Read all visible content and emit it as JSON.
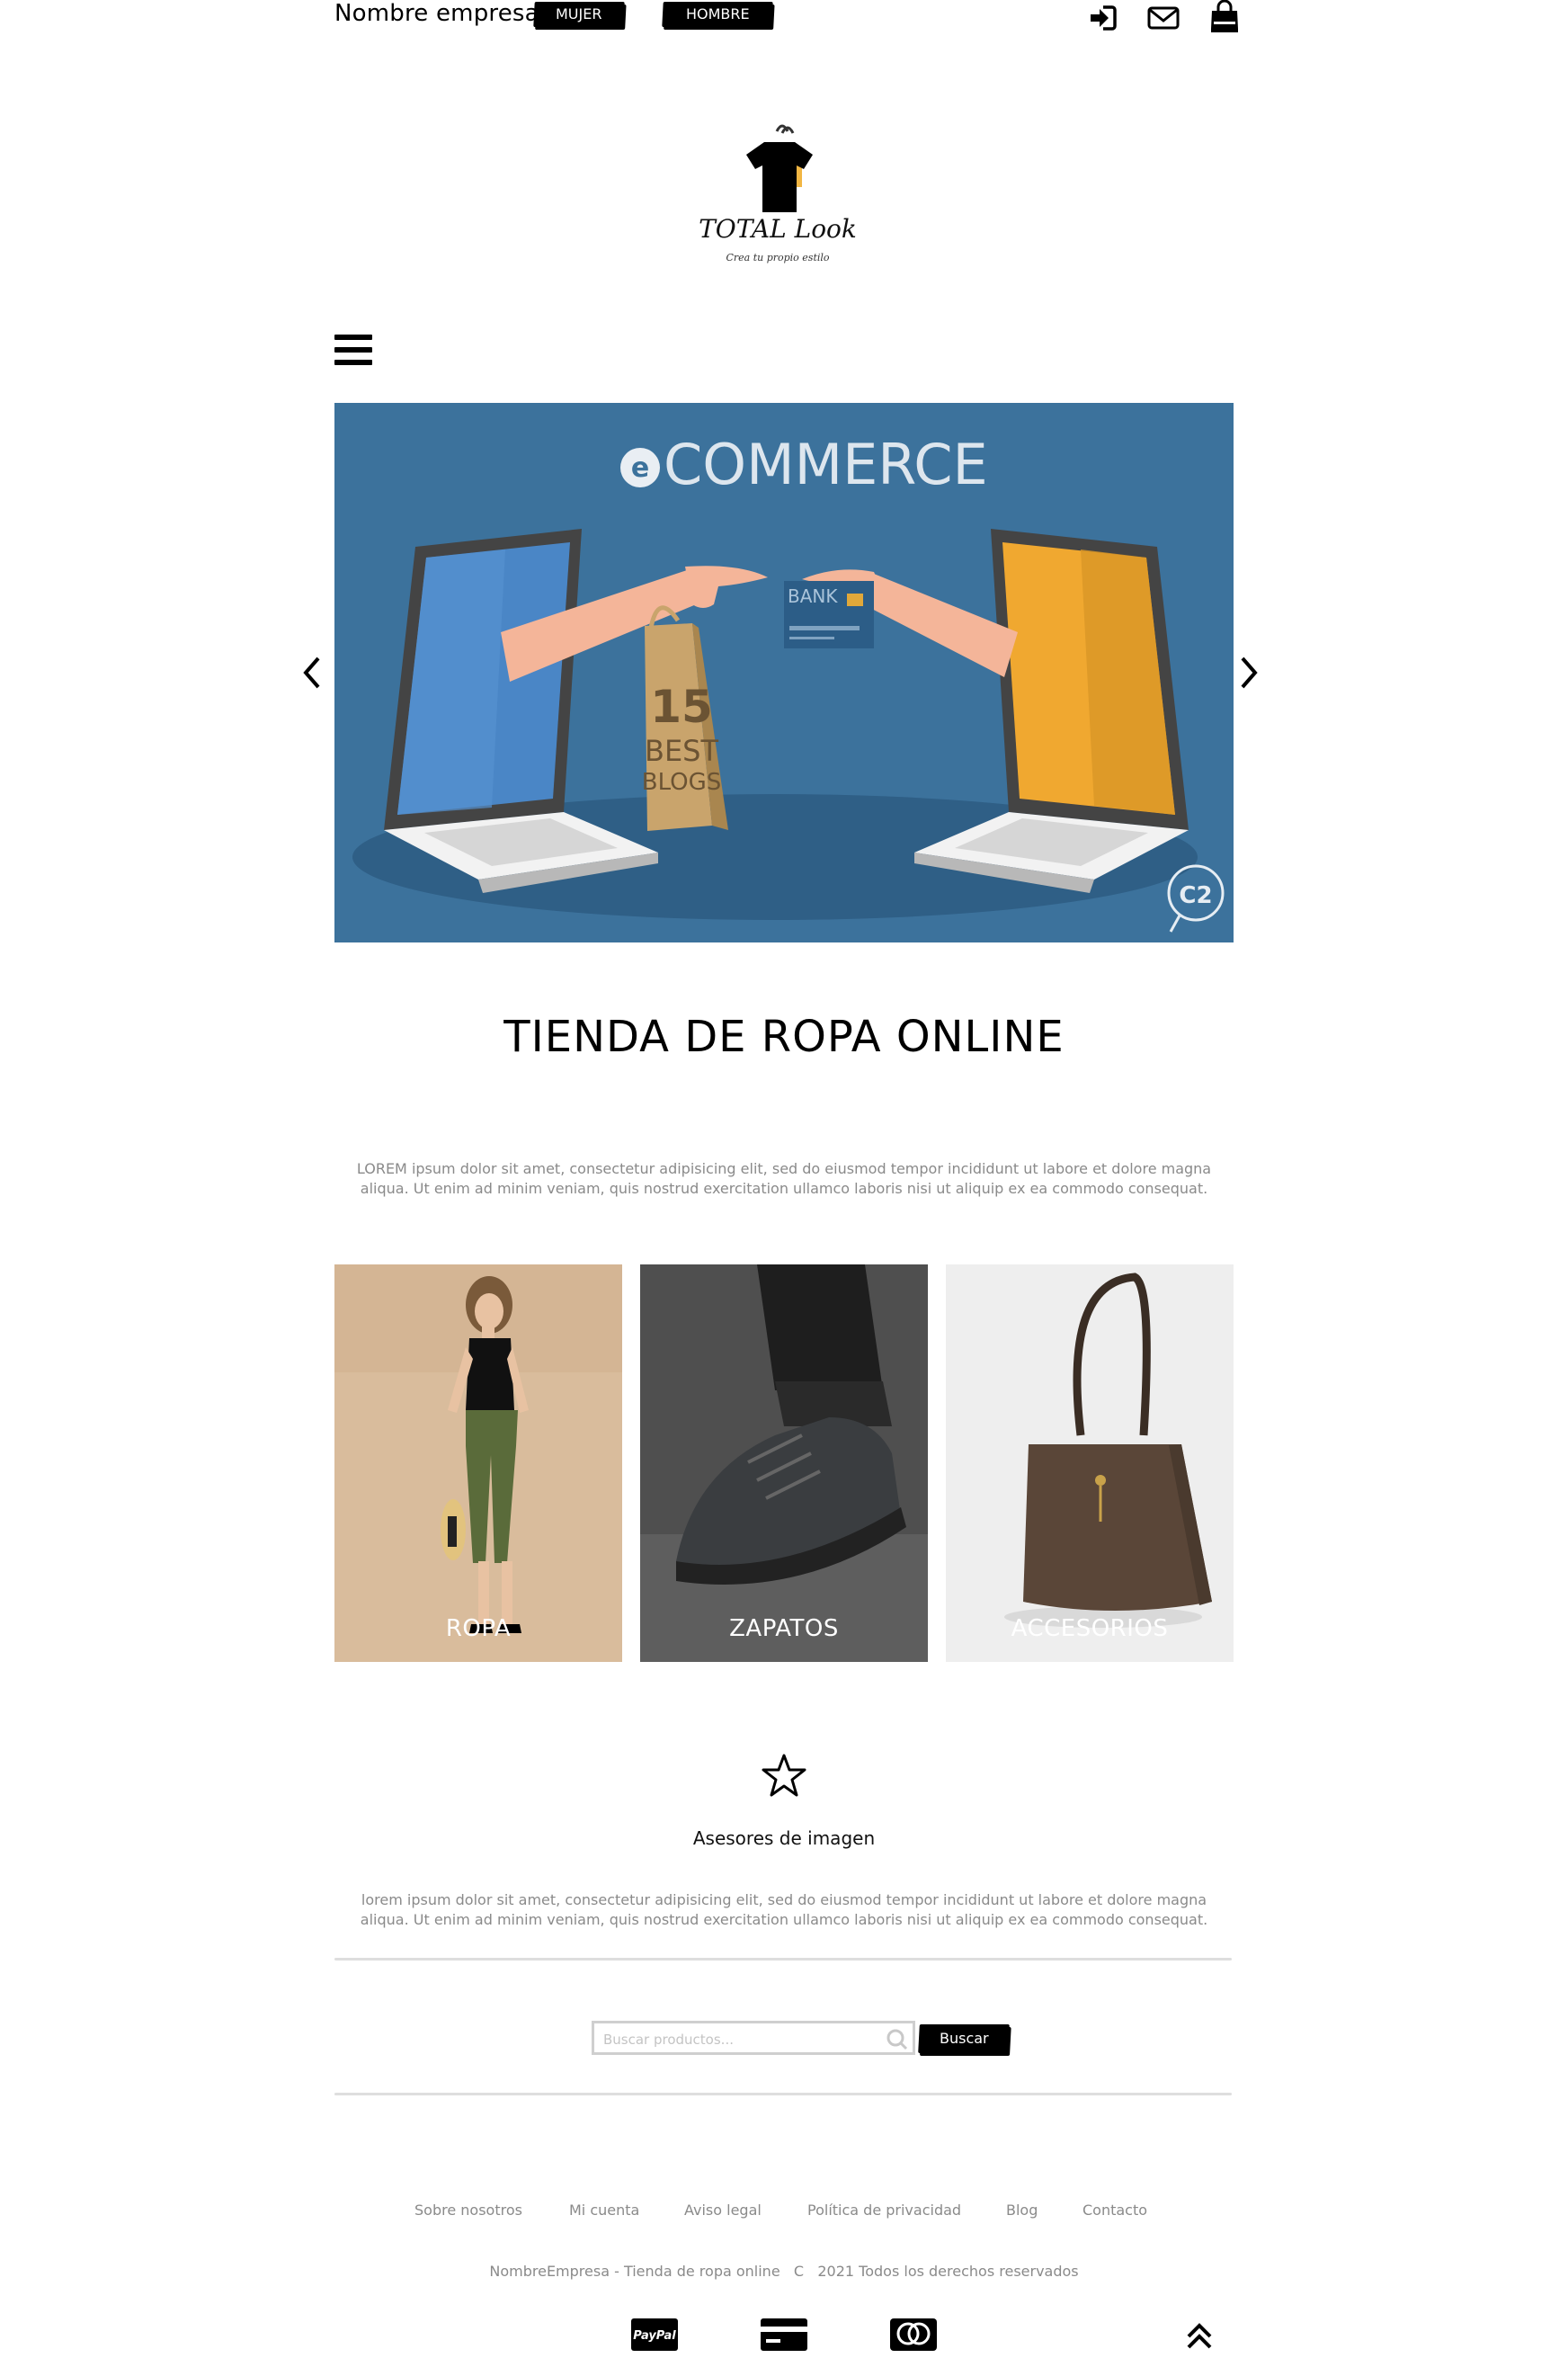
{
  "header": {
    "brand": "Nombre empresa",
    "nav": [
      "MUJER",
      "HOMBRE"
    ],
    "icons": [
      "login-icon",
      "mail-icon",
      "shopping-bag-icon"
    ]
  },
  "logo": {
    "name": "TOTAL Look",
    "tagline": "Crea tu propio estilo"
  },
  "menu_icon": "hamburger-menu-icon",
  "hero": {
    "heading": "COMMERCE",
    "heading_letter": "e",
    "bag_text": [
      "15",
      "BEST",
      "BLOGS"
    ],
    "card_text": "BANK",
    "badge": "C2",
    "colors": {
      "background": "#3c729c",
      "left_screen": "#4a86c6",
      "right_screen": "#f0a830"
    },
    "controls": [
      "chevron-left-icon",
      "chevron-right-icon"
    ]
  },
  "main": {
    "title": "TIENDA DE ROPA ONLINE",
    "intro": [
      "LOREM ipsum dolor sit amet, consectetur adipisicing elit, sed do eiusmod tempor incididunt ut labore et dolore magna",
      "aliqua. Ut enim ad minim veniam, quis nostrud exercitation ullamco laboris nisi ut aliquip ex ea commodo consequat."
    ]
  },
  "categories": [
    {
      "label": "ROPA"
    },
    {
      "label": "ZAPATOS"
    },
    {
      "label": "ACCESORIOS"
    }
  ],
  "advisors": {
    "icon": "star-icon",
    "title": "Asesores de imagen",
    "text": [
      "lorem ipsum dolor sit amet, consectetur adipisicing elit, sed do eiusmod tempor incididunt ut labore et dolore magna",
      "aliqua. Ut enim ad minim veniam, quis nostrud exercitation ullamco laboris nisi ut aliquip ex ea commodo consequat."
    ]
  },
  "search": {
    "placeholder": "Buscar productos...",
    "button": "Buscar",
    "icon": "search-icon"
  },
  "footer": {
    "links": [
      "Sobre nosotros",
      "Mi cuenta",
      "Aviso legal",
      "Política de privacidad",
      "Blog",
      "Contacto"
    ],
    "copyright": "NombreEmpresa - Tienda de ropa online   C   2021 Todos los derechos reservados",
    "payments": {
      "paypal": "PayPal"
    },
    "payment_icons": [
      "paypal-icon",
      "credit-card-icon",
      "mastercard-icon"
    ],
    "scroll_top_icon": "double-chevron-up-icon"
  }
}
